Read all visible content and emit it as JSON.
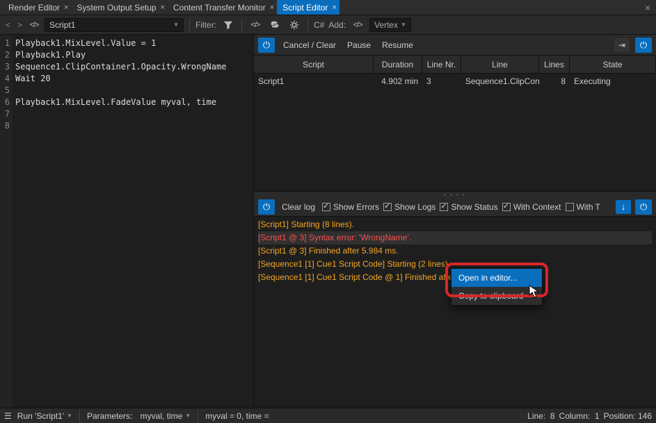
{
  "tabs": [
    {
      "label": "Render Editor"
    },
    {
      "label": "System Output Setup"
    },
    {
      "label": "Content Transfer Monitor"
    },
    {
      "label": "Script Editor",
      "active": true
    }
  ],
  "toolbar": {
    "script_name": "Script1",
    "filter_label": "Filter:",
    "cs_label": "C#",
    "add_label": "Add:",
    "vertex_label": "Vertex"
  },
  "code_lines": [
    "Playback1.MixLevel.Value = 1",
    "Playback1.Play",
    "Sequence1.ClipContainer1.Opacity.WrongName",
    "Wait 20",
    "",
    "Playback1.MixLevel.FadeValue myval, time",
    "",
    ""
  ],
  "runbar": {
    "cancel": "Cancel / Clear",
    "pause": "Pause",
    "resume": "Resume"
  },
  "grid": {
    "headers": {
      "script": "Script",
      "duration": "Duration",
      "lineNr": "Line Nr.",
      "line": "Line",
      "lines": "Lines",
      "state": "State"
    },
    "rows": [
      {
        "script": "Script1",
        "duration": "4.902 min",
        "lineNr": "3",
        "line": "Sequence1.ClipCon",
        "lines": "8",
        "state": "Executing"
      }
    ]
  },
  "logbar": {
    "clear": "Clear log",
    "showErrors": "Show Errors",
    "showLogs": "Show Logs",
    "showStatus": "Show Status",
    "withContext": "With Context",
    "withT": "With T"
  },
  "log": [
    {
      "cls": "l-start",
      "text": "[Script1] Starting (8 lines)."
    },
    {
      "cls": "l-err",
      "text": "[Script1 @ 3] Syntax error: 'WrongName'."
    },
    {
      "cls": "l-fin",
      "text": "[Script1 @ 3] Finished after 5.984 ms."
    },
    {
      "cls": "l-start",
      "text": "[Sequence1 [1] Cue1 Script Code] Starting (2 lines)."
    },
    {
      "cls": "l-fin",
      "text": "[Sequence1 [1] Cue1 Script Code @ 1] Finished after"
    }
  ],
  "context_menu": {
    "open": "Open in editor...",
    "copy": "Copy to clipboard"
  },
  "status": {
    "run": "Run 'Script1'",
    "params_label": "Parameters:",
    "params": "myval, time",
    "values": "myval = 0, time =",
    "line_label": "Line:",
    "line": "8",
    "col_label": "Column:",
    "col": "1",
    "pos_label": "Position:",
    "pos": "146"
  }
}
